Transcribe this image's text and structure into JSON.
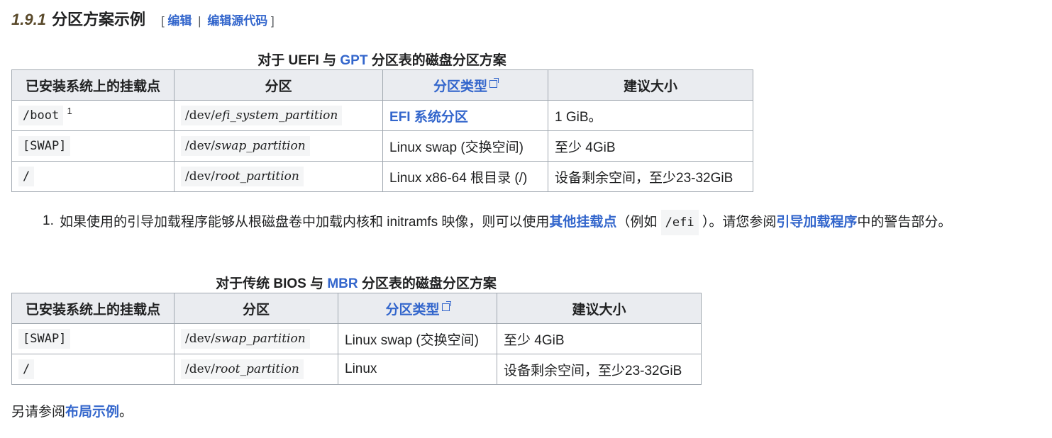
{
  "heading": {
    "number": "1.9.1",
    "title": "分区方案示例",
    "bracket_open": "[",
    "edit": "编辑",
    "separator": "|",
    "edit_source": "编辑源代码",
    "bracket_close": "]"
  },
  "uefi": {
    "caption_pre": "对于 UEFI 与 ",
    "caption_link": "GPT",
    "caption_post": " 分区表的磁盘分区方案",
    "headers": [
      "已安装系统上的挂载点",
      "分区",
      "分区类型",
      "建议大小"
    ],
    "rows": [
      {
        "mount": "/boot",
        "sup": "1",
        "dev": "/dev/",
        "part": "efi_system_partition",
        "type": "EFI 系统分区",
        "size": "1 GiB。"
      },
      {
        "mount": "[SWAP]",
        "dev": "/dev/",
        "part": "swap_partition",
        "type": "Linux swap (交换空间)",
        "size": "至少 4GiB"
      },
      {
        "mount": "/",
        "dev": "/dev/",
        "part": "root_partition",
        "type": "Linux x86-64 根目录 (/)",
        "size": "设备剩余空间，至少23-32GiB"
      }
    ]
  },
  "note": {
    "num": "1.",
    "t1": "如果使用的引导加载程序能够从根磁盘卷中加载内核和 initramfs 映像，则可以使用",
    "link1": "其他挂载点",
    "t2": "（例如 ",
    "code": "/efi",
    "t3": " ）。请您参阅",
    "link2": "引导加载程序",
    "t4": "中的警告部分。"
  },
  "bios": {
    "caption_pre": "对于传统 BIOS 与 ",
    "caption_link": "MBR",
    "caption_post": " 分区表的磁盘分区方案",
    "headers": [
      "已安装系统上的挂载点",
      "分区",
      "分区类型",
      "建议大小"
    ],
    "rows": [
      {
        "mount": "[SWAP]",
        "dev": "/dev/",
        "part": "swap_partition",
        "type": "Linux swap (交换空间)",
        "size": "至少 4GiB"
      },
      {
        "mount": "/",
        "dev": "/dev/",
        "part": "root_partition",
        "type": "Linux",
        "size": "设备剩余空间，至少23-32GiB"
      }
    ]
  },
  "footer": {
    "pre": "另请参阅",
    "link": "布局示例",
    "post": "。"
  }
}
